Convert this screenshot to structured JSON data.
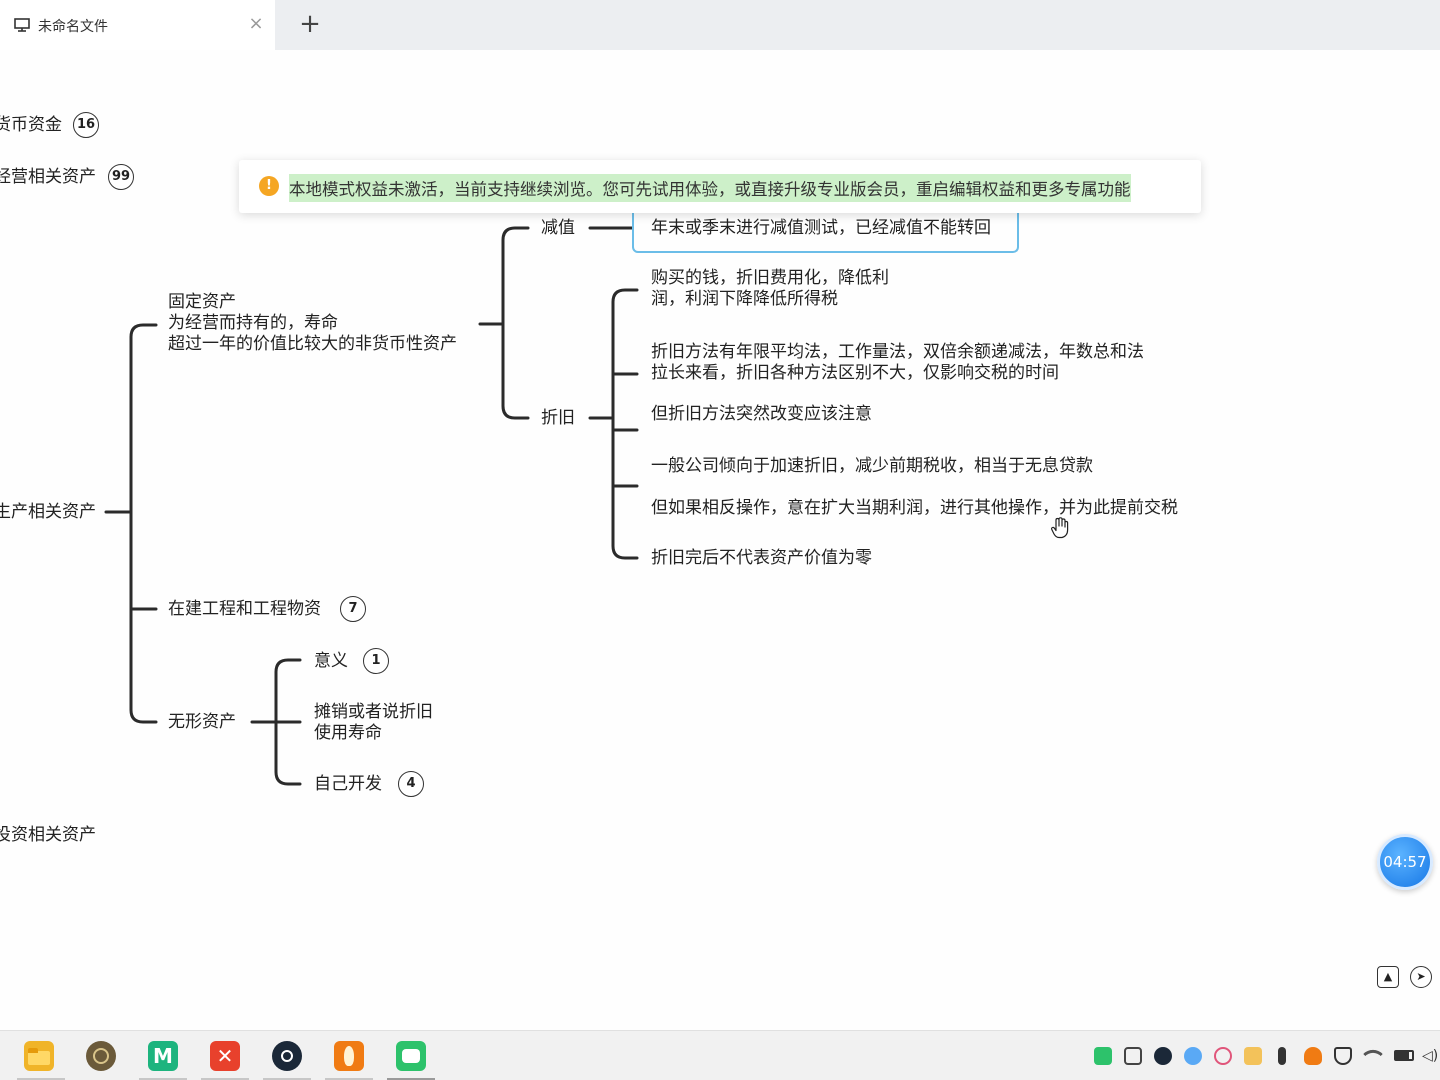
{
  "tab": {
    "title": "未命名文件",
    "close": "×",
    "new": "+"
  },
  "notice": {
    "icon": "!",
    "text": "本地模式权益未激活，当前支持继续浏览。您可先试用体验，或直接升级专业版会员，重启编辑权益和更多专属功能"
  },
  "mindmap": {
    "monetary_funds": {
      "label": "货币资金",
      "count": "16"
    },
    "operating_assets": {
      "label": "经营相关资产",
      "count": "99"
    },
    "production_assets": {
      "label": "生产相关资产"
    },
    "investment_assets": {
      "label": "投资相关资产"
    },
    "fixed_assets": {
      "line1": "固定资产",
      "line2": "为经营而持有的，寿命",
      "line3": "超过一年的价值比较大的非货币性资产"
    },
    "impairment": {
      "label": "减值",
      "note": "年末或季末进行减值测试，已经减值不能转回"
    },
    "depreciation": {
      "label": "折旧",
      "items": [
        {
          "line1": "购买的钱，折旧费用化，降低利",
          "line2": "润，利润下降降低所得税"
        },
        {
          "line1": "折旧方法有年限平均法，工作量法，双倍余额递减法，年数总和法",
          "line2": "拉长来看，折旧各种方法区别不大，仅影响交税的时间"
        },
        {
          "line1": "但折旧方法突然改变应该注意"
        },
        {
          "line1": "一般公司倾向于加速折旧，减少前期税收，相当于无息贷款"
        },
        {
          "line1": "但如果相反操作，意在扩大当期利润，进行其他操作，并为此提前交税"
        },
        {
          "line1": "折旧完后不代表资产价值为零"
        }
      ]
    },
    "construction": {
      "label": "在建工程和工程物资",
      "count": "7"
    },
    "intangible": {
      "label": "无形资产",
      "meaning": {
        "label": "意义",
        "count": "1"
      },
      "amortization": {
        "line1": "摊销或者说折旧",
        "line2": "使用寿命"
      },
      "self_dev": {
        "label": "自己开发",
        "count": "4"
      }
    }
  },
  "timer": "04:57",
  "icons": [
    "monitor-icon",
    "close-icon",
    "plus-icon",
    "warning-icon",
    "expand-icon",
    "locate-icon",
    "hand-cursor-icon"
  ],
  "taskbar": {
    "apps": [
      {
        "name": "file-explorer",
        "color": "#f0b429"
      },
      {
        "name": "compass-app",
        "color": "#6b5a3a"
      },
      {
        "name": "mindmaster",
        "color": "#1db47e"
      },
      {
        "name": "xmind",
        "color": "#e8412c"
      },
      {
        "name": "steam",
        "color": "#1b2838"
      },
      {
        "name": "huorong",
        "color": "#f07b13"
      },
      {
        "name": "mindmap-app",
        "color": "#2dc26b"
      }
    ],
    "tray": [
      "wechat",
      "capture",
      "steam",
      "baidu-netdisk",
      "app",
      "file-manager",
      "microphone",
      "fire",
      "security",
      "wifi",
      "battery",
      "volume"
    ]
  }
}
